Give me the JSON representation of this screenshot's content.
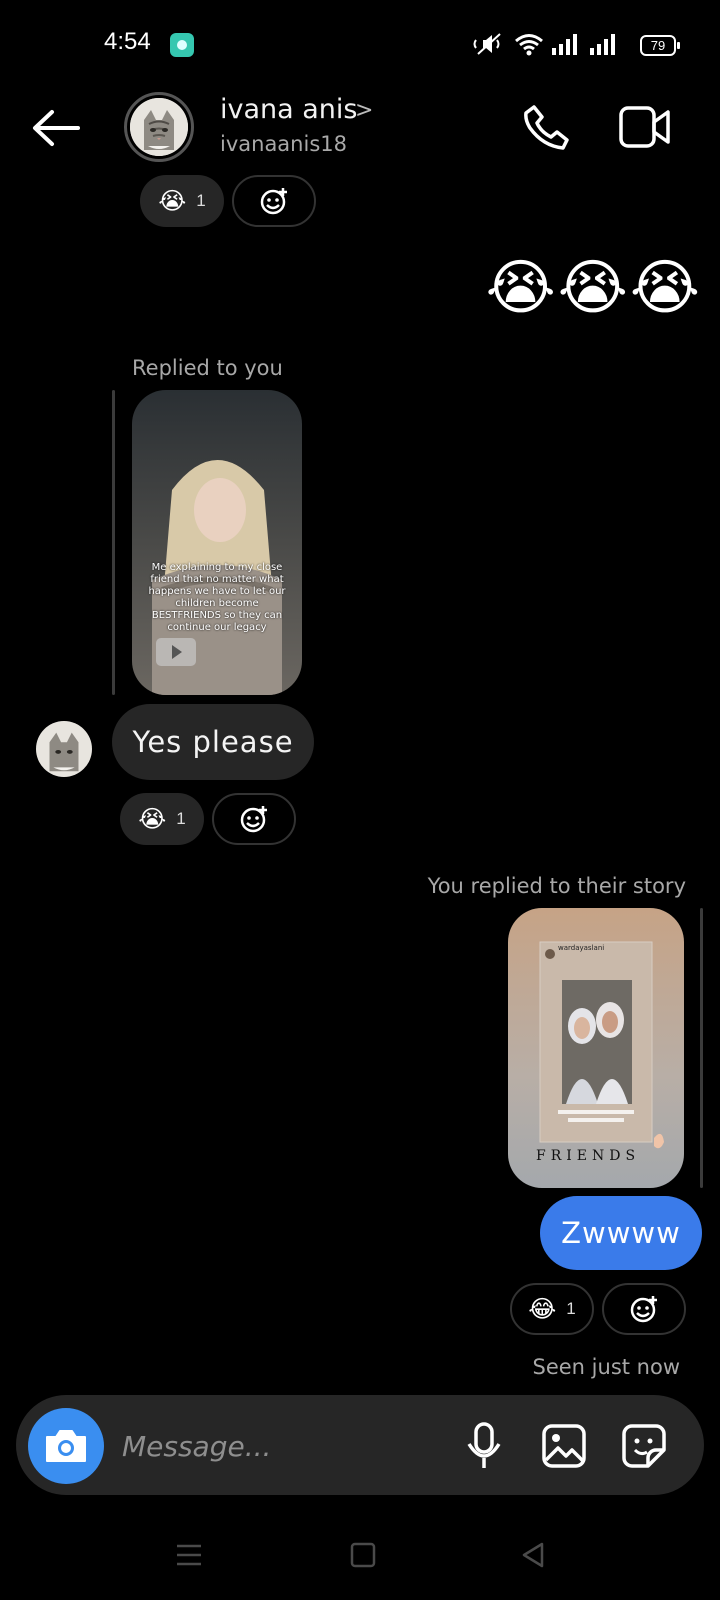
{
  "status_bar": {
    "time": "4:54",
    "battery": "79"
  },
  "header": {
    "name": "ivana anis",
    "username": "ivanaanis18"
  },
  "messages": {
    "top_reaction": {
      "emoji": "😭",
      "count": "1"
    },
    "big_emojis": "😭😭😭",
    "reply_label": "Replied to you",
    "reel_caption": "Me explaining to my close friend that no matter what happens we have to let our children become BESTFRIENDS so they can continue our legacy",
    "yes_please": "Yes please",
    "yes_reaction": {
      "emoji": "😭",
      "count": "1"
    },
    "story_reply_label": "You replied to their story",
    "story_user": "wardayaslani",
    "story_friends_text": "FRIENDS",
    "zwwww": "Zwwww",
    "zwwww_reaction": {
      "emoji": "😂",
      "count": "1"
    },
    "seen": "Seen just now"
  },
  "composer": {
    "placeholder": "Message..."
  },
  "colors": {
    "sent_bubble": "#3a7bea",
    "camera_button": "#3a8ef0",
    "received_bubble": "#262626"
  }
}
